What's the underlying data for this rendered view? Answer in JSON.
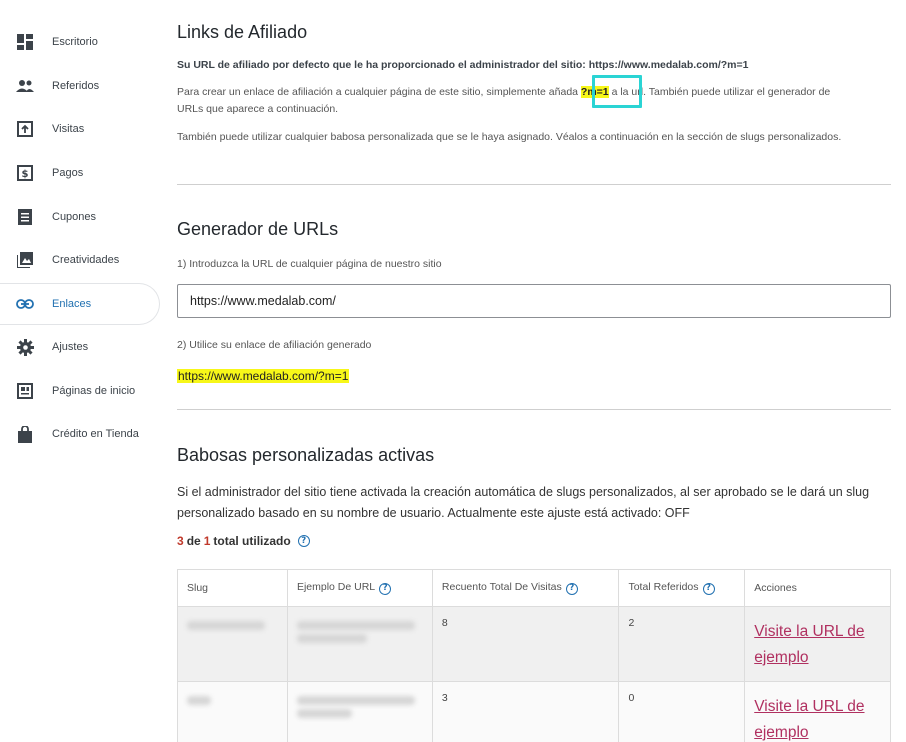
{
  "sidebar": {
    "items": [
      {
        "label": "Escritorio",
        "icon": "dashboard-icon"
      },
      {
        "label": "Referidos",
        "icon": "people-icon"
      },
      {
        "label": "Visitas",
        "icon": "visits-icon"
      },
      {
        "label": "Pagos",
        "icon": "payment-icon"
      },
      {
        "label": "Cupones",
        "icon": "coupon-icon"
      },
      {
        "label": "Creatividades",
        "icon": "image-icon"
      },
      {
        "label": "Enlaces",
        "icon": "link-icon",
        "active": true
      },
      {
        "label": "Ajustes",
        "icon": "gear-icon"
      },
      {
        "label": "Páginas de inicio",
        "icon": "landing-page-icon"
      },
      {
        "label": "Crédito en Tienda",
        "icon": "shopping-bag-icon"
      }
    ],
    "active_color": "#2271b1"
  },
  "links": {
    "title": "Links de Afiliado",
    "default_url_line": "Su URL de afiliado por defecto que le ha proporcionado el administrador del sitio: https://www.medalab.com/?m=1",
    "create_text_before": "Para crear un enlace de afiliación a cualquier página de este sitio, simplemente añada ",
    "param_highlight": "?m=1",
    "create_text_after": " a la url. También puede utilizar el generador de",
    "create_text_line2": "URLs que aparece a continuación.",
    "slug_info": "También puede utilizar cualquier babosa personalizada que se le haya asignado. Véalos a continuación en la sección de slugs personalizados."
  },
  "generator": {
    "title": "Generador de URLs",
    "step1_label": "1) Introduzca la URL de cualquier página de nuestro sitio",
    "input_value": "https://www.medalab.com/",
    "step2_label": "2) Utilice su enlace de afiliación generado",
    "generated_url": "https://www.medalab.com/?m=1"
  },
  "custom_slugs": {
    "title": "Babosas personalizadas activas",
    "description_line1": "Si el administrador del sitio tiene activada la creación automática de slugs personalizados, al ser aprobado se le dará un slug",
    "description_line2": "personalizado basado en su nombre de usuario. Actualmente este ajuste está activado: OFF",
    "used": "3",
    "de": "de",
    "total": "1",
    "total_label": "total utilizado",
    "table": {
      "headers": [
        "Slug",
        "Ejemplo De URL",
        "Recuento Total De Visitas",
        "Total Referidos",
        "Acciones"
      ],
      "rows": [
        {
          "visits": "8",
          "referrals": "2",
          "action": "Visite la URL de ejemplo"
        },
        {
          "visits": "3",
          "referrals": "0",
          "action": "Visite la URL de ejemplo"
        }
      ]
    }
  },
  "colors": {
    "highlight": "#f7f719",
    "annotation_box": "#2ad4d4",
    "link": "#b03060"
  }
}
